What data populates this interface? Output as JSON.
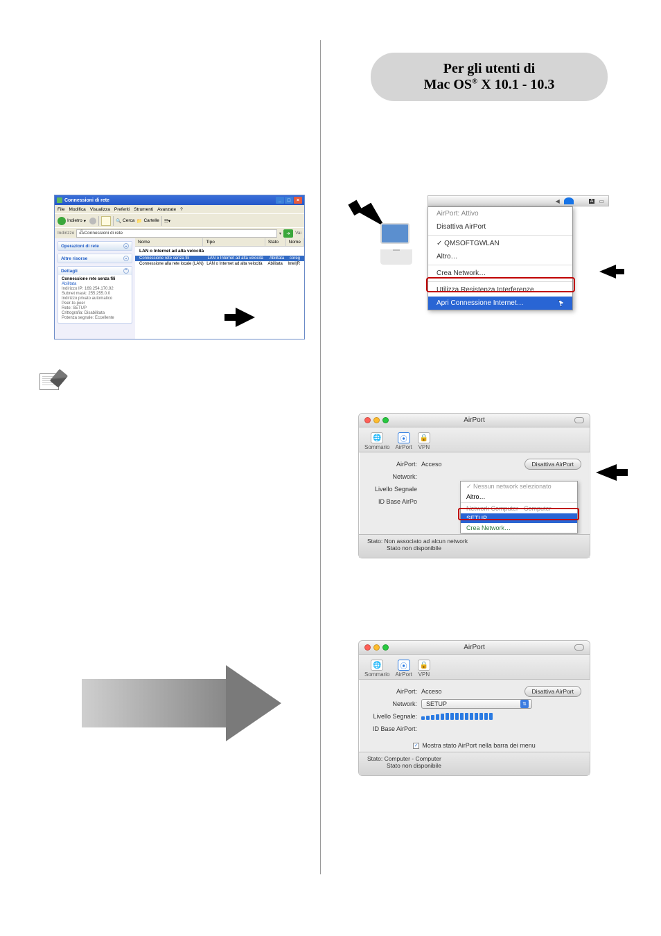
{
  "header": {
    "line1": "Per gli utenti di",
    "line2_pre": "Mac OS",
    "line2_sup": "®",
    "line2_post": " X 10.1 - 10.3"
  },
  "xp": {
    "title": "Connessioni di rete",
    "menu": [
      "File",
      "Modifica",
      "Visualizza",
      "Preferiti",
      "Strumenti",
      "Avanzate",
      "?"
    ],
    "toolbar": {
      "back": "Indietro",
      "search": "Cerca",
      "folders": "Cartelle"
    },
    "address_label": "Indirizzo",
    "address_value": "Connessioni di rete",
    "go": "Vai",
    "panels": {
      "ops": "Operazioni di rete",
      "other": "Altre risorse",
      "details": "Dettagli"
    },
    "details": {
      "title": "Connessione rete senza fili",
      "state": "Abilitata",
      "ip": "Indirizzo IP: 169.254.170.92",
      "mask": "Subnet mask: 255.255.0.0",
      "auto": "Indirizzo privato automatico",
      "peer": "Peer-to-peer",
      "net": "Rete: SETUP",
      "crypt": "Crittografia: Disabilitata",
      "signal": "Potenza segnale: Eccellente"
    },
    "columns": [
      "Nome",
      "Tipo",
      "Stato",
      "Nome"
    ],
    "group_heading": "LAN o Internet ad alta velocità",
    "rows": [
      {
        "name": "Connessione rete senza fili",
        "type": "LAN o Internet ad alta velocità",
        "state": "Abilitata",
        "dev": "coreg"
      },
      {
        "name": "Connessione alla rete locale (LAN)",
        "type": "LAN o Internet ad alta velocità",
        "state": "Abilitata",
        "dev": "Intel(R"
      }
    ]
  },
  "mac_menu": {
    "status": "AirPort: Attivo",
    "disable": "Disattiva AirPort",
    "network": "QMSOFTGWLAN",
    "other": "Altro…",
    "create": "Crea Network…",
    "interference": "Utilizza Resistenza Interferenze",
    "open": "Apri Connessione Internet…"
  },
  "airport1": {
    "title": "AirPort",
    "tabs": {
      "sommario": "Sommario",
      "airport": "AirPort",
      "vpn": "VPN"
    },
    "rows": {
      "airport_label": "AirPort:",
      "airport_value": "Acceso",
      "disable_btn": "Disattiva AirPort",
      "network_label": "Network:",
      "level_label": "Livello Segnale",
      "id_label": "ID Base AirPo"
    },
    "popup": {
      "none": "Nessun network selezionato",
      "other": "Altro…",
      "c2c": "Network Computer - Computer",
      "setup": "SETUP",
      "create": "Crea Network…"
    },
    "status_label": "Stato:",
    "status_line1": "Non associato ad alcun network",
    "status_line2": "Stato non disponibile"
  },
  "airport2": {
    "title": "AirPort",
    "tabs": {
      "sommario": "Sommario",
      "airport": "AirPort",
      "vpn": "VPN"
    },
    "rows": {
      "airport_label": "AirPort:",
      "airport_value": "Acceso",
      "disable_btn": "Disattiva AirPort",
      "network_label": "Network:",
      "network_value": "SETUP",
      "level_label": "Livello Segnale:",
      "id_label": "ID Base AirPort:",
      "show_label": "Mostra stato AirPort nella barra dei menu"
    },
    "status_label": "Stato:",
    "status_line1": "Computer - Computer",
    "status_line2": "Stato non disponibile"
  }
}
